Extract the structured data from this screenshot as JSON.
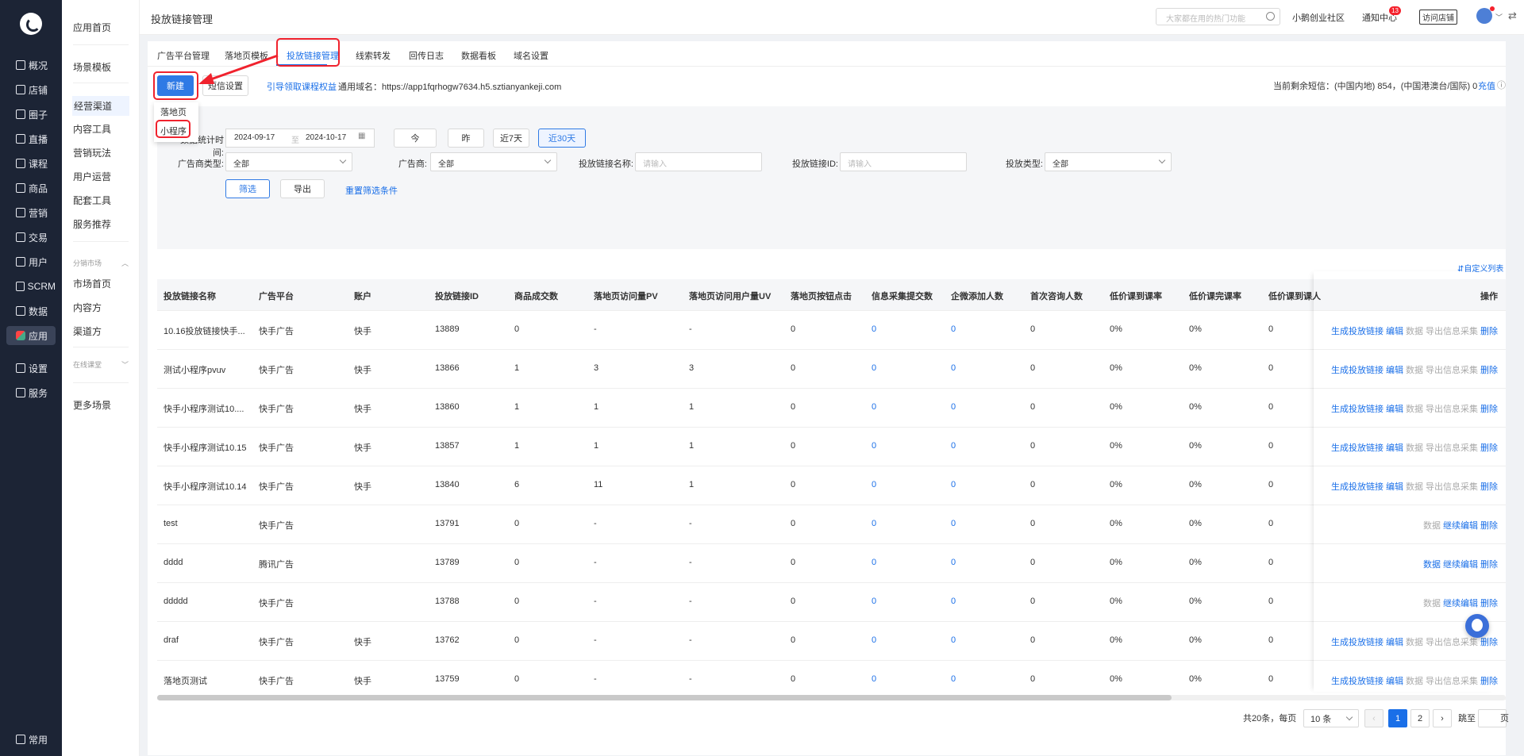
{
  "nav": {
    "items": [
      "概况",
      "店铺",
      "圈子",
      "直播",
      "课程",
      "商品",
      "营销",
      "交易",
      "用户",
      "SCRM",
      "数据",
      "应用",
      "设置",
      "服务"
    ],
    "footer": "常用"
  },
  "submenu": {
    "items": [
      "应用首页",
      "场景模板",
      "经营渠道",
      "内容工具",
      "营销玩法",
      "用户运营",
      "配套工具",
      "服务推荐",
      "市场首页",
      "内容方",
      "渠道方",
      "更多场景"
    ],
    "groups": [
      "分销市场",
      "在线课堂"
    ]
  },
  "header": {
    "title": "投放链接管理",
    "search_placeholder": "大家都在用的热门功能",
    "community": "小鹅创业社区",
    "notice": "通知中心",
    "notice_badge": "13",
    "visit": "访问店铺"
  },
  "tabs": [
    "广告平台管理",
    "落地页模板",
    "投放链接管理",
    "线索转发",
    "回传日志",
    "数据看板",
    "域名设置"
  ],
  "toolbar": {
    "new_label": "新建",
    "sms_label": "短信设置",
    "guide_link": "引导领取课程权益",
    "domain_text": "通用域名：https://app1fqrhogw7634.h5.sztianyankeji.com",
    "sms_remaining": "当前剩余短信：(中国内地) 854，(中国港澳台/国际) 0",
    "recharge": "充值"
  },
  "dropdown": [
    "落地页",
    "小程序"
  ],
  "filter": {
    "date_label": "数据统计时间:",
    "date_start": "2024-09-17",
    "date_sep": "至",
    "date_end": "2024-10-17",
    "quick": [
      "今",
      "昨",
      "近7天",
      "近30天"
    ],
    "ad_type_label": "广告商类型:",
    "ad_type_value": "全部",
    "adv_label": "广告商:",
    "adv_value": "全部",
    "name_label": "投放链接名称:",
    "name_placeholder": "请输入",
    "id_label": "投放链接ID:",
    "id_placeholder": "请输入",
    "type_label": "投放类型:",
    "type_value": "全部",
    "filter_btn": "筛选",
    "export_btn": "导出",
    "reset_link": "重置筛选条件"
  },
  "custom_cols": "自定义列表",
  "table": {
    "headers": [
      "投放链接名称",
      "广告平台",
      "账户",
      "投放链接ID",
      "商品成交数",
      "落地页访问量PV",
      "落地页访问用户量UV",
      "落地页按钮点击",
      "信息采集提交数",
      "企微添加人数",
      "首次咨询人数",
      "低价课到课率",
      "低价课完课率",
      "低价课到课人",
      "操作"
    ],
    "rows": [
      [
        "10.16投放链接快手...",
        "快手广告",
        "快手",
        "13889",
        "0",
        "-",
        "-",
        "0",
        "0",
        "0",
        "0",
        "0%",
        "0%",
        "0"
      ],
      [
        "测试小程序pvuv",
        "快手广告",
        "快手",
        "13866",
        "1",
        "3",
        "3",
        "0",
        "0",
        "0",
        "0",
        "0%",
        "0%",
        "0"
      ],
      [
        "快手小程序测试10....",
        "快手广告",
        "快手",
        "13860",
        "1",
        "1",
        "1",
        "0",
        "0",
        "0",
        "0",
        "0%",
        "0%",
        "0"
      ],
      [
        "快手小程序测试10.15",
        "快手广告",
        "快手",
        "13857",
        "1",
        "1",
        "1",
        "0",
        "0",
        "0",
        "0",
        "0%",
        "0%",
        "0"
      ],
      [
        "快手小程序测试10.14",
        "快手广告",
        "快手",
        "13840",
        "6",
        "11",
        "1",
        "0",
        "0",
        "0",
        "0",
        "0%",
        "0%",
        "0"
      ],
      [
        "test",
        "快手广告",
        "",
        "13791",
        "0",
        "-",
        "-",
        "0",
        "0",
        "0",
        "0",
        "0%",
        "0%",
        "0"
      ],
      [
        "dddd",
        "腾讯广告",
        "",
        "13789",
        "0",
        "-",
        "-",
        "0",
        "0",
        "0",
        "0",
        "0%",
        "0%",
        "0"
      ],
      [
        "ddddd",
        "快手广告",
        "",
        "13788",
        "0",
        "-",
        "-",
        "0",
        "0",
        "0",
        "0",
        "0%",
        "0%",
        "0"
      ],
      [
        "draf",
        "快手广告",
        "快手",
        "13762",
        "0",
        "-",
        "-",
        "0",
        "0",
        "0",
        "0",
        "0%",
        "0%",
        "0"
      ],
      [
        "落地页测试",
        "快手广告",
        "快手",
        "13759",
        "0",
        "-",
        "-",
        "0",
        "0",
        "0",
        "0",
        "0%",
        "0%",
        "0"
      ]
    ],
    "ops_full": [
      "生成投放链接",
      "编辑",
      "数据",
      "导出信息采集",
      "删除"
    ],
    "ops_short_grey": [
      "数据",
      "继续编辑",
      "删除"
    ],
    "ops_short_blue": [
      "数据",
      "继续编辑",
      "删除"
    ]
  },
  "pager": {
    "total": "共20条，每页",
    "per_page": "10 条",
    "pages": [
      "1",
      "2"
    ],
    "jump": "跳至",
    "page_unit": "页"
  }
}
